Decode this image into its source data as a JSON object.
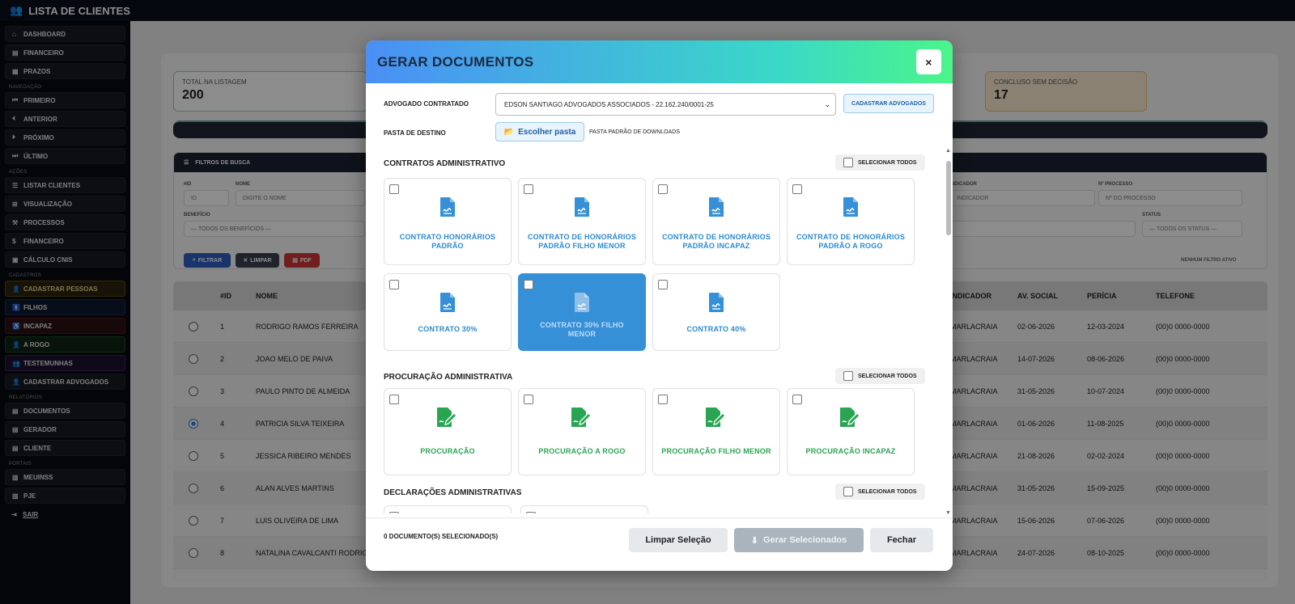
{
  "app": {
    "title": "LISTA DE CLIENTES"
  },
  "sidebar": {
    "top_items": [
      {
        "label": "DASHBOARD"
      },
      {
        "label": "FINANCEIRO"
      },
      {
        "label": "PRAZOS"
      }
    ],
    "sections": {
      "nav": "NAVEGAÇÃO",
      "acoes": "AÇÕES",
      "cadastros": "CADASTROS",
      "relatorios": "RELATÓRIOS",
      "portais": "PORTAIS"
    },
    "nav_items": [
      {
        "label": "PRIMEIRO"
      },
      {
        "label": "ANTERIOR"
      },
      {
        "label": "PRÓXIMO"
      },
      {
        "label": "ÚLTIMO"
      }
    ],
    "acao_items": [
      {
        "label": "LISTAR CLIENTES"
      },
      {
        "label": "VISUALIZAÇÃO"
      },
      {
        "label": "PROCESSOS"
      },
      {
        "label": "FINANCEIRO"
      },
      {
        "label": "CÁLCULO CNIS"
      }
    ],
    "cadastro_items": [
      {
        "label": "CADASTRAR PESSOAS"
      },
      {
        "label": "FILHOS"
      },
      {
        "label": "INCAPAZ"
      },
      {
        "label": "A ROGO"
      },
      {
        "label": "TESTEMUNHAS"
      },
      {
        "label": "CADASTRAR ADVOGADOS"
      }
    ],
    "relatorio_items": [
      {
        "label": "DOCUMENTOS"
      },
      {
        "label": "GERADOR"
      },
      {
        "label": "CLIENTE"
      }
    ],
    "portal_items": [
      {
        "label": "MEUINSS"
      },
      {
        "label": "PJE"
      },
      {
        "label": "SAIR"
      }
    ]
  },
  "stats": [
    {
      "label": "TOTAL NA LISTAGEM",
      "value": "200"
    },
    {
      "label": "CONCLUSO SEM DECISÃO",
      "value": "17"
    }
  ],
  "filters": {
    "title": "FILTROS DE BUSCA",
    "labels": {
      "id": "#ID",
      "nome": "NOME",
      "beneficio": "BENEFÍCIO",
      "indicador": "INDICADOR",
      "processo": "Nº PROCESSO",
      "status": "STATUS"
    },
    "placeholders": {
      "id": "ID",
      "nome": "DIGITE O NOME",
      "indicador": "INDICADOR",
      "processo": "Nº DO PROCESSO"
    },
    "beneficio_value": "— TODOS OS BENEFÍCIOS —",
    "status_value": "— TODOS OS STATUS —",
    "buttons": {
      "filtrar": "FILTRAR",
      "limpar": "LIMPAR",
      "pdf": "PDF"
    },
    "no_filter": "NENHUM FILTRO ATIVO"
  },
  "table": {
    "headers": {
      "id": "#ID",
      "nome": "NOME",
      "indicador": "INDICADOR",
      "av_social": "AV. SOCIAL",
      "pericia": "PERÍCIA",
      "telefone": "TELEFONE"
    },
    "rows": [
      {
        "id": "1",
        "nome": "RODRIGO RAMOS FERREIRA",
        "indicador": "MARLACRAIA",
        "av_social": "02-06-2026",
        "pericia": "12-03-2024",
        "telefone": "(00)0 0000-0000"
      },
      {
        "id": "2",
        "nome": "JOAO MELO DE PAIVA",
        "indicador": "MARLACRAIA",
        "av_social": "14-07-2026",
        "pericia": "08-06-2026",
        "telefone": "(00)0 0000-0000"
      },
      {
        "id": "3",
        "nome": "PAULO PINTO DE ALMEIDA",
        "indicador": "MARLACRAIA",
        "av_social": "31-05-2026",
        "pericia": "10-07-2024",
        "telefone": "(00)0 0000-0000"
      },
      {
        "id": "4",
        "nome": "PATRICIA SILVA TEIXEIRA",
        "indicador": "MARLACRAIA",
        "av_social": "01-06-2026",
        "pericia": "11-08-2025",
        "telefone": "(00)0 0000-0000"
      },
      {
        "id": "5",
        "nome": "JESSICA RIBEIRO MENDES",
        "indicador": "MARLACRAIA",
        "av_social": "21-08-2026",
        "pericia": "02-02-2024",
        "telefone": "(00)0 0000-0000"
      },
      {
        "id": "6",
        "nome": "ALAN ALVES MARTINS",
        "indicador": "MARLACRAIA",
        "av_social": "31-05-2026",
        "pericia": "15-09-2025",
        "telefone": "(00)0 0000-0000"
      },
      {
        "id": "7",
        "nome": "LUIS OLIVEIRA DE LIMA",
        "indicador": "MARLACRAIA",
        "av_social": "15-06-2026",
        "pericia": "07-06-2026",
        "telefone": "(00)0 0000-0000"
      },
      {
        "id": "8",
        "nome": "NATALINA CAVALCANTI RODRIGU",
        "indicador": "MARLACRAIA",
        "av_social": "24-07-2026",
        "pericia": "08-10-2025",
        "telefone": "(00)0 0000-0000"
      }
    ]
  },
  "modal": {
    "title": "GERAR DOCUMENTOS",
    "close": "×",
    "advogado_label": "ADVOGADO CONTRATADO",
    "advogado_value": "EDSON SANTIAGO ADVOGADOS ASSOCIADOS - 22.162.240/0001-25",
    "cadastrar_btn": "CADASTRAR ADVOGADOS",
    "pasta_label": "PASTA DE DESTINO",
    "pasta_btn": "Escolher pasta",
    "pasta_hint": "PASTA PADRÃO DE DOWNLOADS",
    "select_all": "SELECIONAR TODOS",
    "sections": {
      "contratos": {
        "title": "CONTRATOS ADMINISTRATIVO",
        "docs": [
          {
            "label": "CONTRATO HONORÁRIOS PADRÃO"
          },
          {
            "label": "CONTRATO DE HONORÁRIOS PADRÃO FILHO MENOR"
          },
          {
            "label": "CONTRATO DE HONORÁRIOS PADRÃO INCAPAZ"
          },
          {
            "label": "CONTRATO DE HONORÁRIOS PADRÃO A ROGO"
          },
          {
            "label": "CONTRATO 30%"
          },
          {
            "label": "CONTRATO 30% FILHO MENOR"
          },
          {
            "label": "CONTRATO 40%"
          }
        ]
      },
      "procuracao": {
        "title": "PROCURAÇÃO ADMINISTRATIVA",
        "docs": [
          {
            "label": "PROCURAÇÃO"
          },
          {
            "label": "PROCURAÇÃO A ROGO"
          },
          {
            "label": "PROCURAÇÃO FILHO MENOR"
          },
          {
            "label": "PROCURAÇÃO INCAPAZ"
          }
        ]
      },
      "declaracoes": {
        "title": "DECLARAÇÕES ADMINISTRATIVAS"
      }
    },
    "footer": {
      "count": "0 DOCUMENTO(S) SELECIONADO(S)",
      "limpar": "Limpar Seleção",
      "gerar": "Gerar Selecionados",
      "fechar": "Fechar"
    }
  },
  "colors": {
    "accent": "#3690d8",
    "green": "#29a552",
    "gradient_start": "#4a8ff5",
    "gradient_end": "#4af58a"
  }
}
